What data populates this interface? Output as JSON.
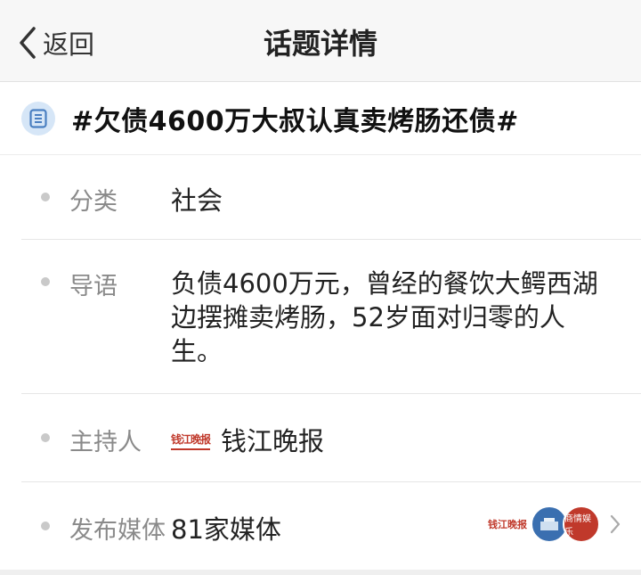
{
  "nav": {
    "back_label": "返回",
    "title": "话题详情"
  },
  "topic": {
    "title": "#欠债4600万大叔认真卖烤肠还债#",
    "icon": "list-document-icon"
  },
  "details": {
    "category": {
      "label": "分类",
      "value": "社会"
    },
    "intro": {
      "label": "导语",
      "value": "负债4600万元，曾经的餐饮大鳄西湖边摆摊卖烤肠，52岁面对归零的人生。"
    },
    "host": {
      "label": "主持人",
      "logo_text": "钱江晚报",
      "value": "钱江晚报"
    },
    "media": {
      "label": "发布媒体",
      "value": "81家媒体",
      "logo_texts": [
        "钱江晚报",
        "商情娱乐"
      ]
    }
  },
  "colors": {
    "accent_blue": "#3a6fb0",
    "accent_red": "#c0392b",
    "label_gray": "#8a8a8a"
  }
}
